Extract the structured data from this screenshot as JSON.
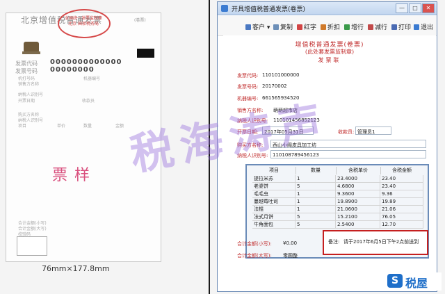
{
  "left_sample": {
    "title": "北京增值税普通发票",
    "title_tag": "(卷票)",
    "seal_text": "全国统一发票监制章 北京 国家税务局",
    "code_label": "发票代码",
    "code_value": "0000000000000",
    "number_label": "发票号码",
    "number_value": "00000000",
    "machine_label": "机打号码",
    "machine_no_label": "机器编号",
    "seller_label": "销售方名称",
    "taxpayer_label": "纳税人识别号",
    "date_label": "开票日期",
    "cashier_label": "收款员",
    "buyer_label": "购买方名称",
    "buyer_taxpayer_label": "纳税人识别号",
    "col_item": "项目",
    "col_price": "单价",
    "col_qty": "数量",
    "col_amount": "金额",
    "sample_text": "票样",
    "total_small_label": "合计金额(小写)",
    "total_big_label": "合计金额(大写)",
    "check_label": "校验码",
    "size_text": "76mm×177.8mm"
  },
  "window": {
    "title": "开具增值税普通发票(卷票)",
    "buttons": {
      "minimize": "—",
      "maximize": "□",
      "close": "✕"
    },
    "toolbar": [
      {
        "label": "客户",
        "icon": "customer-icon",
        "color": "#4a78c2"
      },
      {
        "label": "复制",
        "icon": "copy-icon",
        "color": "#6d8fb8"
      },
      {
        "label": "红字",
        "icon": "red-invoice-icon",
        "color": "#d24444"
      },
      {
        "label": "折扣",
        "icon": "discount-icon",
        "color": "#d07a2a"
      },
      {
        "label": "增行",
        "icon": "add-row-icon",
        "color": "#3a9a4a"
      },
      {
        "label": "减行",
        "icon": "remove-row-icon",
        "color": "#c24a4a"
      },
      {
        "label": "打印",
        "icon": "print-icon",
        "color": "#4a6ab2"
      },
      {
        "label": "退出",
        "icon": "exit-icon",
        "color": "#3b7bd1"
      }
    ]
  },
  "invoice": {
    "title": "增值税普通发票(卷票)",
    "subtitle": "(此处套发票监制章)",
    "lian": "发票联",
    "code_label": "发票代码:",
    "code_value": "110101000000",
    "number_label": "发票号码:",
    "number_value": "20170002",
    "machine_label": "机器编号:",
    "machine_value": "661565934520",
    "seller_name_label": "销售方名称:",
    "seller_name_value": "萌萌超市店",
    "seller_tax_label": "纳税人识别号:",
    "seller_tax_value": "110101456852123",
    "date_label": "开票日期:",
    "date_value": "2017年05月31日",
    "cashier_label": "收款员:",
    "cashier_value": "管理员1",
    "buyer_name_label": "购买方名称:",
    "buyer_name_value": "西山小阁皮具加工坊",
    "buyer_tax_label": "纳税人识别号:",
    "buyer_tax_value": "110108789456123",
    "columns": [
      "项目",
      "数量",
      "含税单价",
      "含税金额"
    ],
    "rows": [
      [
        "提拉米苏",
        "1",
        "23.4000",
        "23.40"
      ],
      [
        "老婆饼",
        "5",
        "4.6800",
        "23.40"
      ],
      [
        "毛毛虫",
        "1",
        "9.3600",
        "9.36"
      ],
      [
        "蔓越莓吐司",
        "1",
        "19.8900",
        "19.89"
      ],
      [
        "法棍",
        "1",
        "21.0600",
        "21.06"
      ],
      [
        "法式月饼",
        "5",
        "15.2100",
        "76.05"
      ],
      [
        "牛角面包",
        "5",
        "2.5400",
        "12.70"
      ]
    ],
    "total_small_label": "合计金额(小写):",
    "total_small_value": "¥0.00",
    "total_big_label": "合计金额(大写):",
    "total_big_value": "零圆整",
    "remark_label": "备注:",
    "remark_value": "请于2017年6月5日下午2点前送到"
  },
  "watermark": "税海涛声",
  "logo": {
    "mark": "S",
    "text": "税屋"
  },
  "colors": {
    "invoice_red": "#c12e2e",
    "remark_border": "#c51f1f",
    "table_border": "#6a8bb8",
    "watermark": "#9a6edc"
  }
}
